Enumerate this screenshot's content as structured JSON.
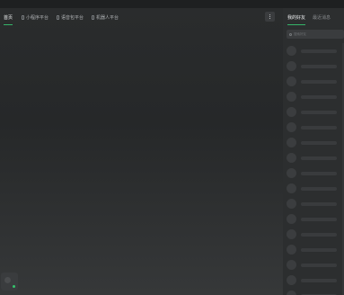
{
  "nav": {
    "items": [
      {
        "label": "首页",
        "active": true
      },
      {
        "label": "小程序平台",
        "active": false
      },
      {
        "label": "语音包平台",
        "active": false
      },
      {
        "label": "机器人平台",
        "active": false
      }
    ],
    "menu_icon": "more-vertical-icon"
  },
  "sidebar": {
    "tabs": [
      {
        "label": "我的好友",
        "active": true
      },
      {
        "label": "最近消息",
        "active": false
      }
    ],
    "search_placeholder": "搜索好友",
    "friend_count_visible": 17
  },
  "colors": {
    "accent": "#35b368",
    "online": "#35c46c",
    "background": "#262829",
    "sidebar": "#2c2e2f"
  }
}
